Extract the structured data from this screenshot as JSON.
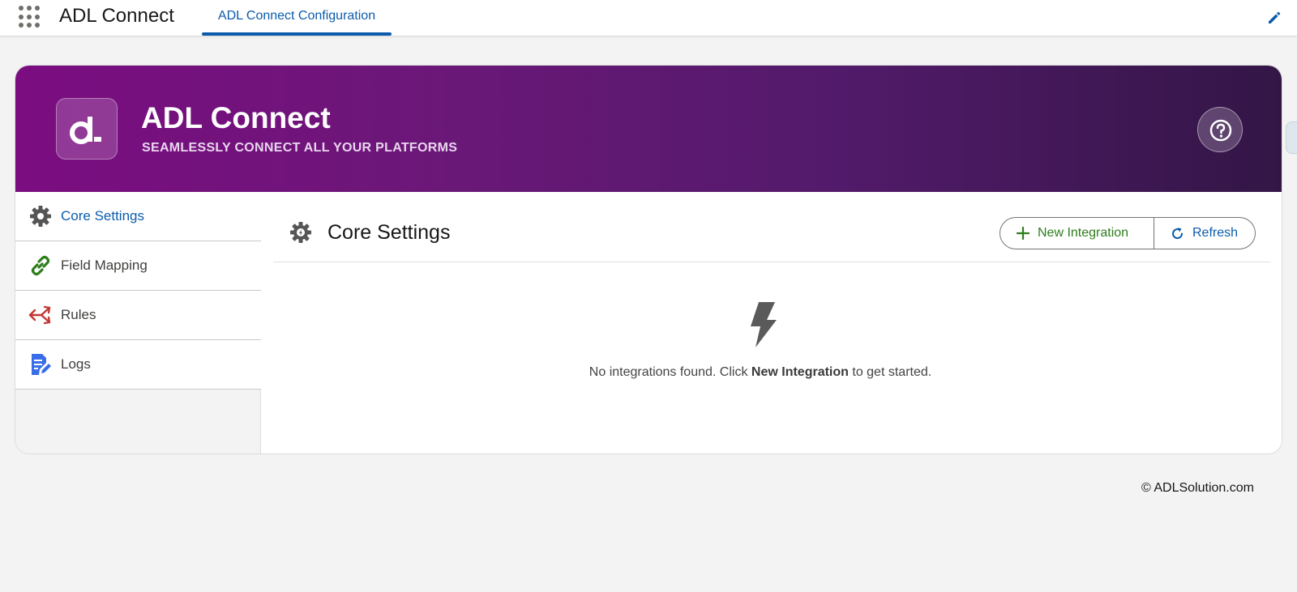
{
  "topbar": {
    "app_name": "ADL Connect",
    "active_tab": "ADL Connect Configuration"
  },
  "hero": {
    "title": "ADL Connect",
    "subtitle": "SEAMLESSLY CONNECT ALL YOUR PLATFORMS",
    "logo_glyph": "a.",
    "help_icon": "question-icon"
  },
  "sidenav": {
    "items": [
      {
        "label": "Core Settings",
        "icon": "gear-icon",
        "active": true
      },
      {
        "label": "Field Mapping",
        "icon": "link-icon",
        "active": false
      },
      {
        "label": "Rules",
        "icon": "split-arrow-icon",
        "active": false
      },
      {
        "label": "Logs",
        "icon": "document-edit-icon",
        "active": false
      }
    ]
  },
  "content": {
    "title": "Core Settings",
    "new_button": "New Integration",
    "refresh_button": "Refresh",
    "empty_text_before": "No integrations found. Click ",
    "empty_text_bold": "New Integration",
    "empty_text_after": " to get started."
  },
  "footer": {
    "copyright": "© ADLSolution.com"
  },
  "colors": {
    "brand_blue": "#0b5cab",
    "hero_start": "#7b0d80",
    "hero_end": "#331646",
    "new_green": "#2e7d1c",
    "rules_red": "#c23934",
    "logs_blue": "#3a6ee8",
    "link_green": "#2e7d1c"
  }
}
